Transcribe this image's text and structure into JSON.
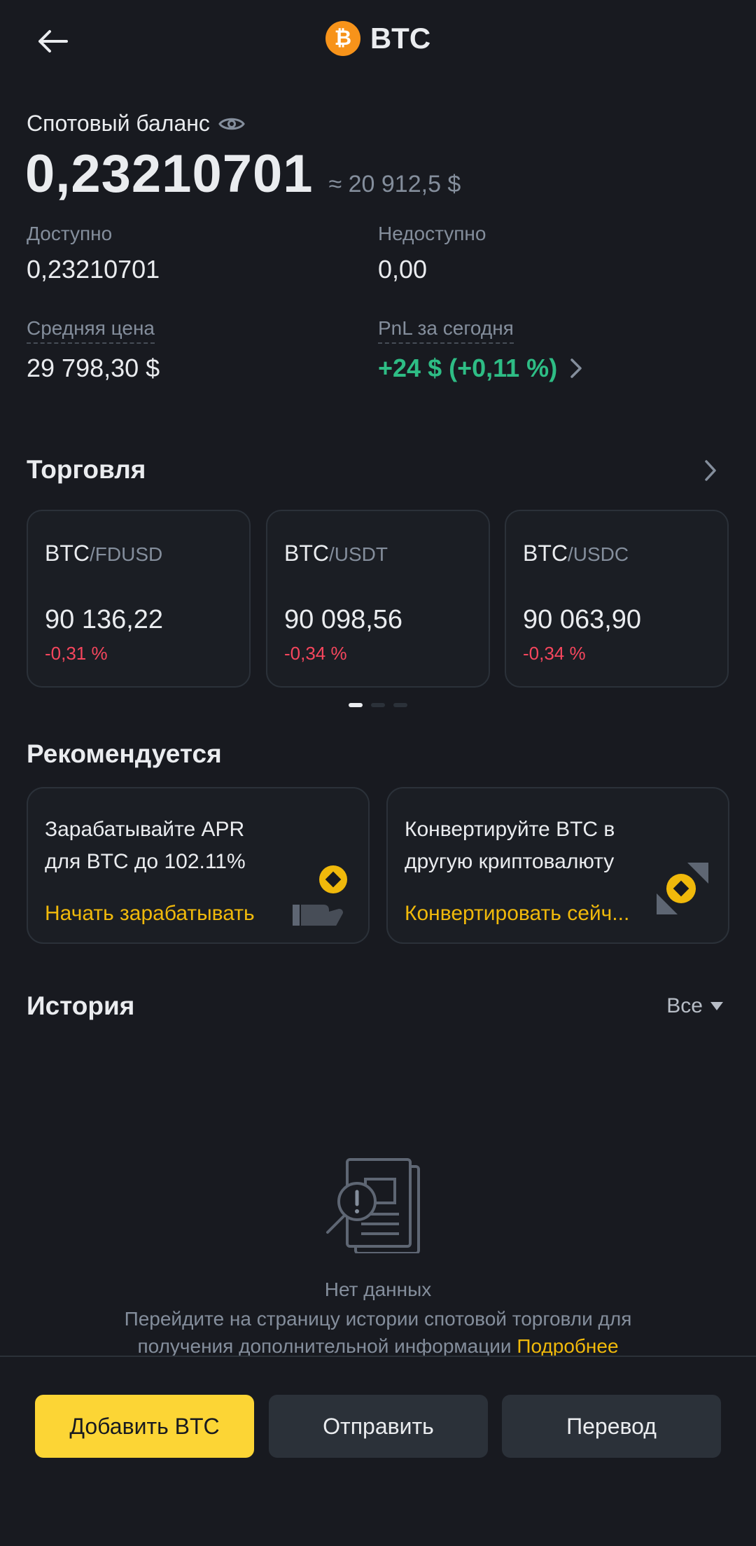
{
  "header": {
    "title": "BTC",
    "coin_symbol": "₿"
  },
  "balance": {
    "label": "Спотовый баланс",
    "amount": "0,23210701",
    "approx": "≈ 20 912,5 $",
    "available_label": "Доступно",
    "available_value": "0,23210701",
    "unavailable_label": "Недоступно",
    "unavailable_value": "0,00",
    "avg_price_label": "Средняя цена",
    "avg_price_value": "29 798,30 $",
    "pnl_label": "PnL за сегодня",
    "pnl_value": "+24 $ (+0,11 %)"
  },
  "trading": {
    "title": "Торговля",
    "pairs": [
      {
        "base": "BTC",
        "quote": "/FDUSD",
        "price": "90 136,22",
        "change": "-0,31 %"
      },
      {
        "base": "BTC",
        "quote": "/USDT",
        "price": "90 098,56",
        "change": "-0,34 %"
      },
      {
        "base": "BTC",
        "quote": "/USDC",
        "price": "90 063,90",
        "change": "-0,34 %"
      }
    ]
  },
  "recommended": {
    "title": "Рекомендуется",
    "cards": [
      {
        "text": "Зарабатывайте APR для BTC до 102.11%",
        "link": "Начать зарабатывать"
      },
      {
        "text": "Конвертируйте BTC в другую криптовалюту",
        "link": "Конвертировать сейч..."
      }
    ]
  },
  "history": {
    "title": "История",
    "filter": "Все",
    "empty_title": "Нет данных",
    "empty_desc": "Перейдите на страницу истории спотовой торговли для получения дополнительной информации",
    "more_link": "Подробнее"
  },
  "actions": {
    "add": "Добавить BTC",
    "send": "Отправить",
    "transfer": "Перевод"
  },
  "colors": {
    "background": "#181a20",
    "accent_yellow": "#fcd535",
    "positive": "#2ebd85",
    "negative": "#f6465d",
    "bitcoin": "#f7931a"
  }
}
